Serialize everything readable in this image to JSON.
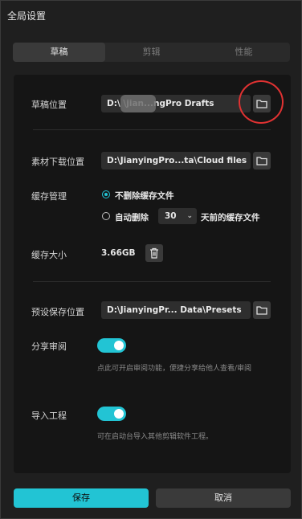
{
  "window": {
    "title": "全局设置"
  },
  "tabs": [
    {
      "label": "草稿",
      "active": true
    },
    {
      "label": "剪辑",
      "active": false
    },
    {
      "label": "性能",
      "active": false
    }
  ],
  "draft": {
    "location_label": "草稿位置",
    "location_path": "D:\\           \\jian...ngPro Drafts"
  },
  "download": {
    "location_label": "素材下载位置",
    "location_path": "D:\\JianyingPro...ta\\Cloud files"
  },
  "cache": {
    "label": "缓存管理",
    "option_keep": "不删除缓存文件",
    "option_auto_prefix": "自动删除",
    "days_value": "30",
    "option_auto_suffix": "天前的缓存文件",
    "size_label": "缓存大小",
    "size_value": "3.66GB"
  },
  "preset": {
    "location_label": "预设保存位置",
    "location_path": "D:\\JianyingPr... Data\\Presets"
  },
  "share_review": {
    "label": "分享审阅",
    "enabled": true,
    "hint": "点此可开启审阅功能，便捷分享给他人查看/审阅"
  },
  "import_project": {
    "label": "导入工程",
    "enabled": true,
    "hint": "可在启动台导入其他剪辑软件工程。"
  },
  "footer": {
    "save_label": "保存",
    "cancel_label": "取消"
  },
  "colors": {
    "accent": "#22c4d4",
    "annotation_circle": "#e03232"
  },
  "icons": [
    "folder-icon",
    "chevron-down-icon",
    "trash-icon"
  ]
}
